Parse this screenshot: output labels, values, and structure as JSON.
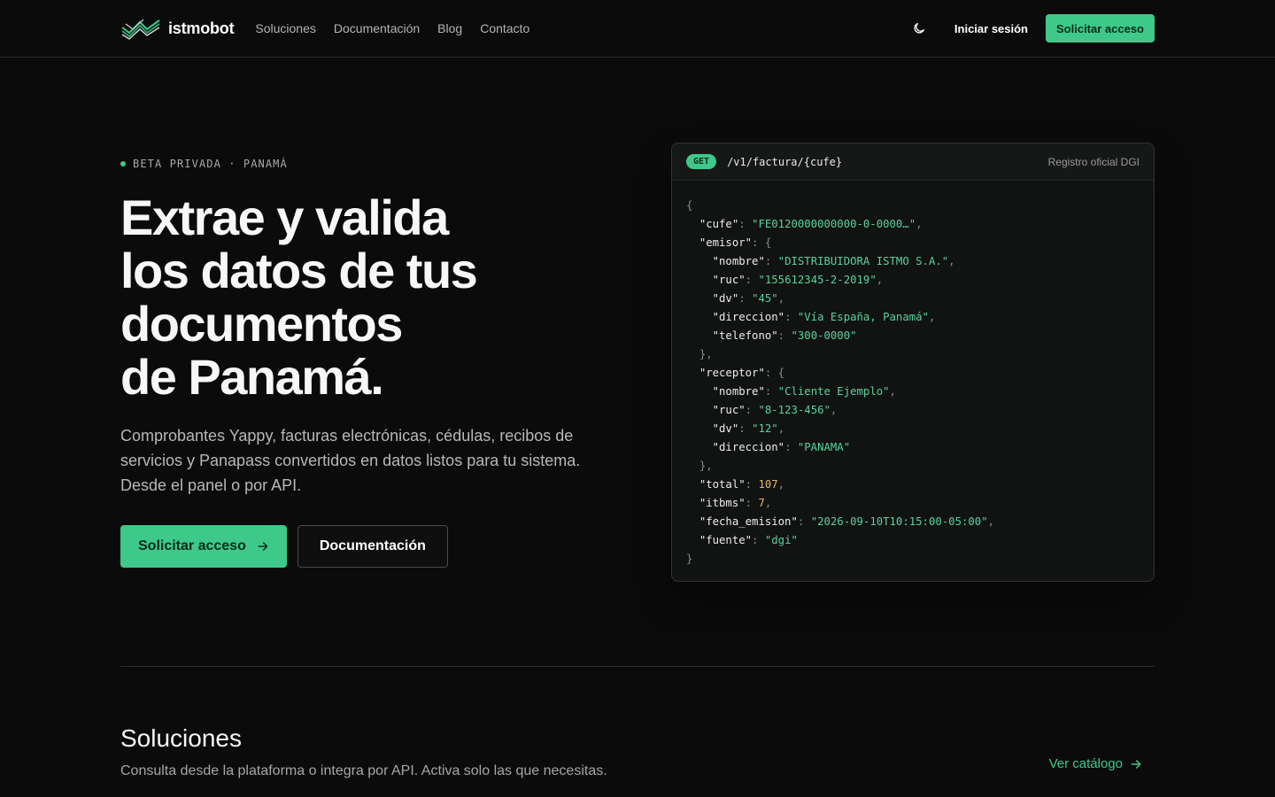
{
  "nav": {
    "brand": "istmobot",
    "links": [
      "Soluciones",
      "Documentación",
      "Blog",
      "Contacto"
    ],
    "theme_icon": "moon-icon",
    "login": "Iniciar sesión",
    "cta": "Solicitar acceso"
  },
  "hero": {
    "badge": "BETA PRIVADA · PANAMÁ",
    "title_lines": [
      "Extrae y valida",
      "los datos de tus",
      "documentos",
      "de Panamá."
    ],
    "description": "Comprobantes Yappy, facturas electrónicas, cédulas, recibos de servicios y Panapass convertidos en datos listos para tu sistema. Desde el panel o por API.",
    "primary_button": "Solicitar acceso",
    "secondary_button": "Documentación"
  },
  "panel": {
    "method": "GET",
    "endpoint": "/v1/factura/{cufe}",
    "tag": "Registro oficial DGI",
    "response": {
      "cufe": "FE0120000000000-0-0000…",
      "emisor": {
        "nombre": "DISTRIBUIDORA ISTMO S.A.",
        "ruc": "155612345-2-2019",
        "dv": "45",
        "direccion": "Vía España, Panamá",
        "telefono": "300-0000"
      },
      "receptor": {
        "nombre": "Cliente Ejemplo",
        "ruc": "8-123-456",
        "dv": "12",
        "direccion": "PANAMA"
      },
      "total": 107,
      "itbms": 7,
      "fecha_emision": "2026-09-10T10:15:00-05:00",
      "fuente": "dgi"
    }
  },
  "solutions": {
    "title": "Soluciones",
    "description": "Consulta desde la plataforma o integra por API. Activa solo las que necesitas.",
    "link": "Ver catálogo"
  },
  "colors": {
    "accent": "#3ec98a",
    "background": "#0b0b0b",
    "panel": "#111212"
  }
}
